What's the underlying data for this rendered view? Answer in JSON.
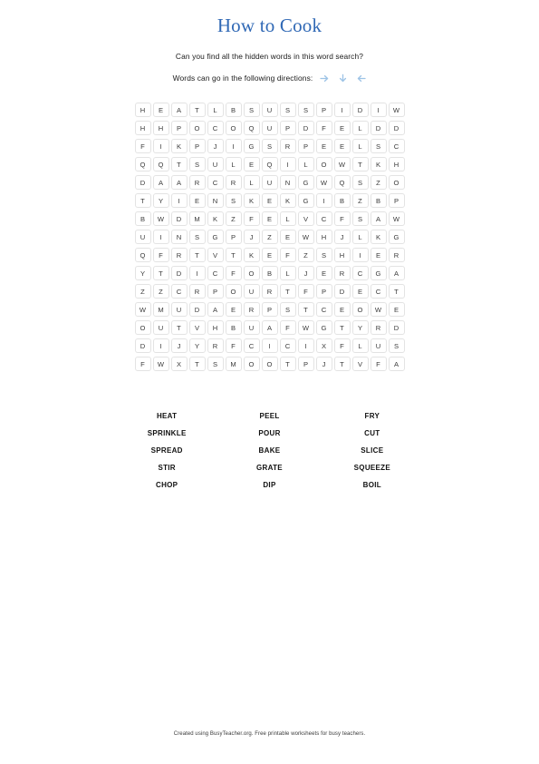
{
  "header": {
    "title": "How to Cook",
    "title_color": "#2f68b5",
    "instruction_line_1": "Can you find all the hidden words in this word search?",
    "instruction_line_2": "Words can go in the following directions:",
    "directions": [
      {
        "icon": "arrow-right-icon",
        "label": "right"
      },
      {
        "icon": "arrow-down-icon",
        "label": "down"
      },
      {
        "icon": "arrow-left-icon",
        "label": "left"
      }
    ],
    "arrow_color": "#9dc3e6"
  },
  "grid": {
    "rows": 15,
    "columns": 15,
    "letters": [
      [
        "H",
        "E",
        "A",
        "T",
        "L",
        "B",
        "S",
        "U",
        "S",
        "S",
        "P",
        "I",
        "D",
        "I",
        "W"
      ],
      [
        "H",
        "H",
        "P",
        "O",
        "C",
        "O",
        "Q",
        "U",
        "P",
        "D",
        "F",
        "E",
        "L",
        "D",
        "D"
      ],
      [
        "F",
        "I",
        "K",
        "P",
        "J",
        "I",
        "G",
        "S",
        "R",
        "P",
        "E",
        "E",
        "L",
        "S",
        "C"
      ],
      [
        "Q",
        "Q",
        "T",
        "S",
        "U",
        "L",
        "E",
        "Q",
        "I",
        "L",
        "O",
        "W",
        "T",
        "K",
        "H"
      ],
      [
        "D",
        "A",
        "A",
        "R",
        "C",
        "R",
        "L",
        "U",
        "N",
        "G",
        "W",
        "Q",
        "S",
        "Z",
        "O"
      ],
      [
        "T",
        "Y",
        "I",
        "E",
        "N",
        "S",
        "K",
        "E",
        "K",
        "G",
        "I",
        "B",
        "Z",
        "B",
        "P"
      ],
      [
        "B",
        "W",
        "D",
        "M",
        "K",
        "Z",
        "F",
        "E",
        "L",
        "V",
        "C",
        "F",
        "S",
        "A",
        "W"
      ],
      [
        "U",
        "I",
        "N",
        "S",
        "G",
        "P",
        "J",
        "Z",
        "E",
        "W",
        "H",
        "J",
        "L",
        "K",
        "G"
      ],
      [
        "Q",
        "F",
        "R",
        "T",
        "V",
        "T",
        "K",
        "E",
        "F",
        "Z",
        "S",
        "H",
        "I",
        "E",
        "R"
      ],
      [
        "Y",
        "T",
        "D",
        "I",
        "C",
        "F",
        "O",
        "B",
        "L",
        "J",
        "E",
        "R",
        "C",
        "G",
        "A"
      ],
      [
        "Z",
        "Z",
        "C",
        "R",
        "P",
        "O",
        "U",
        "R",
        "T",
        "F",
        "P",
        "D",
        "E",
        "C",
        "T"
      ],
      [
        "W",
        "M",
        "U",
        "D",
        "A",
        "E",
        "R",
        "P",
        "S",
        "T",
        "C",
        "E",
        "O",
        "W",
        "E"
      ],
      [
        "O",
        "U",
        "T",
        "V",
        "H",
        "B",
        "U",
        "A",
        "F",
        "W",
        "G",
        "T",
        "Y",
        "R",
        "D"
      ],
      [
        "D",
        "I",
        "J",
        "Y",
        "R",
        "F",
        "C",
        "I",
        "C",
        "I",
        "X",
        "F",
        "L",
        "U",
        "S"
      ],
      [
        "F",
        "W",
        "X",
        "T",
        "S",
        "M",
        "O",
        "O",
        "T",
        "P",
        "J",
        "T",
        "V",
        "F",
        "A"
      ]
    ]
  },
  "word_list": {
    "columns": 3,
    "words": [
      "HEAT",
      "PEEL",
      "FRY",
      "SPRINKLE",
      "POUR",
      "CUT",
      "SPREAD",
      "BAKE",
      "SLICE",
      "STIR",
      "GRATE",
      "SQUEEZE",
      "CHOP",
      "DIP",
      "BOIL"
    ]
  },
  "footer": {
    "credit": "Created using BusyTeacher.org. Free printable worksheets for busy teachers."
  }
}
